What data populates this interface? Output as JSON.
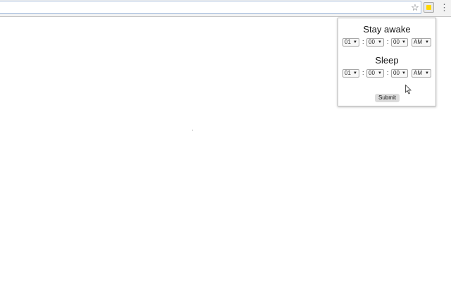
{
  "browser": {
    "star_icon": "star-icon",
    "extension_icon": "sun-extension-icon",
    "menu_icon": "vertical-dots-icon",
    "glyphs": {
      "star": "☆",
      "menu": "⋮"
    }
  },
  "popup": {
    "awake": {
      "title": "Stay awake",
      "hour": "01",
      "minute": "00",
      "second": "00",
      "period": "AM"
    },
    "sleep": {
      "title": "Sleep",
      "hour": "01",
      "minute": "00",
      "second": "00",
      "period": "AM"
    },
    "separator": ":",
    "dropdown_arrow": "▼",
    "submit_label": "Submit"
  },
  "colors": {
    "extension_sun": "#ffd700",
    "submit_bg": "#dcdcdc"
  }
}
